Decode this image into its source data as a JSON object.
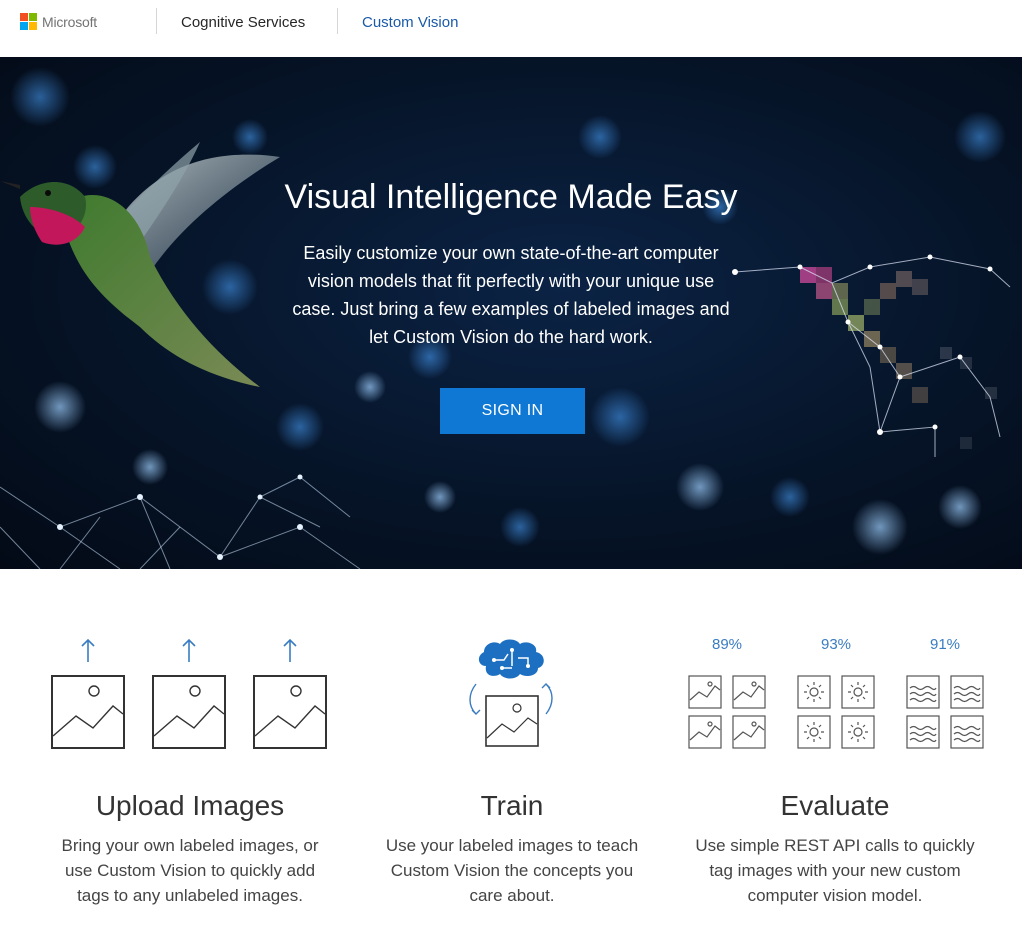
{
  "header": {
    "logo_text": "Microsoft",
    "nav": {
      "cognitive": "Cognitive Services",
      "custom_vision": "Custom Vision"
    }
  },
  "colors": {
    "ms_red": "#f25022",
    "ms_green": "#7fba00",
    "ms_blue": "#00a4ef",
    "ms_yellow": "#ffb900",
    "accent_blue": "#0f78d4",
    "link_blue": "#1a5aa8"
  },
  "hero": {
    "title": "Visual Intelligence Made Easy",
    "desc_lines": [
      "Easily customize your own state-of-the-art computer",
      "vision models that fit perfectly with your unique use",
      "case. Just bring a few examples of labeled images and",
      "let Custom Vision do the hard work."
    ],
    "signin_label": "SIGN IN"
  },
  "features": [
    {
      "title": "Upload Images",
      "desc_lines": [
        "Bring your own labeled images, or",
        "use Custom Vision to quickly add",
        "tags to any unlabeled images."
      ]
    },
    {
      "title": "Train",
      "desc_lines": [
        "Use your labeled images to teach",
        "Custom Vision the concepts you",
        "care about."
      ]
    },
    {
      "title": "Evaluate",
      "desc_lines": [
        "Use simple REST API calls to quickly",
        "tag images with your new custom",
        "computer vision model."
      ]
    }
  ],
  "evaluate": {
    "scores": [
      "89%",
      "93%",
      "91%"
    ]
  },
  "icons": [
    "upload-arrow-icon",
    "image-placeholder-icon",
    "brain-circuit-icon",
    "refresh-arrows-icon",
    "sun-icon",
    "waves-icon"
  ]
}
